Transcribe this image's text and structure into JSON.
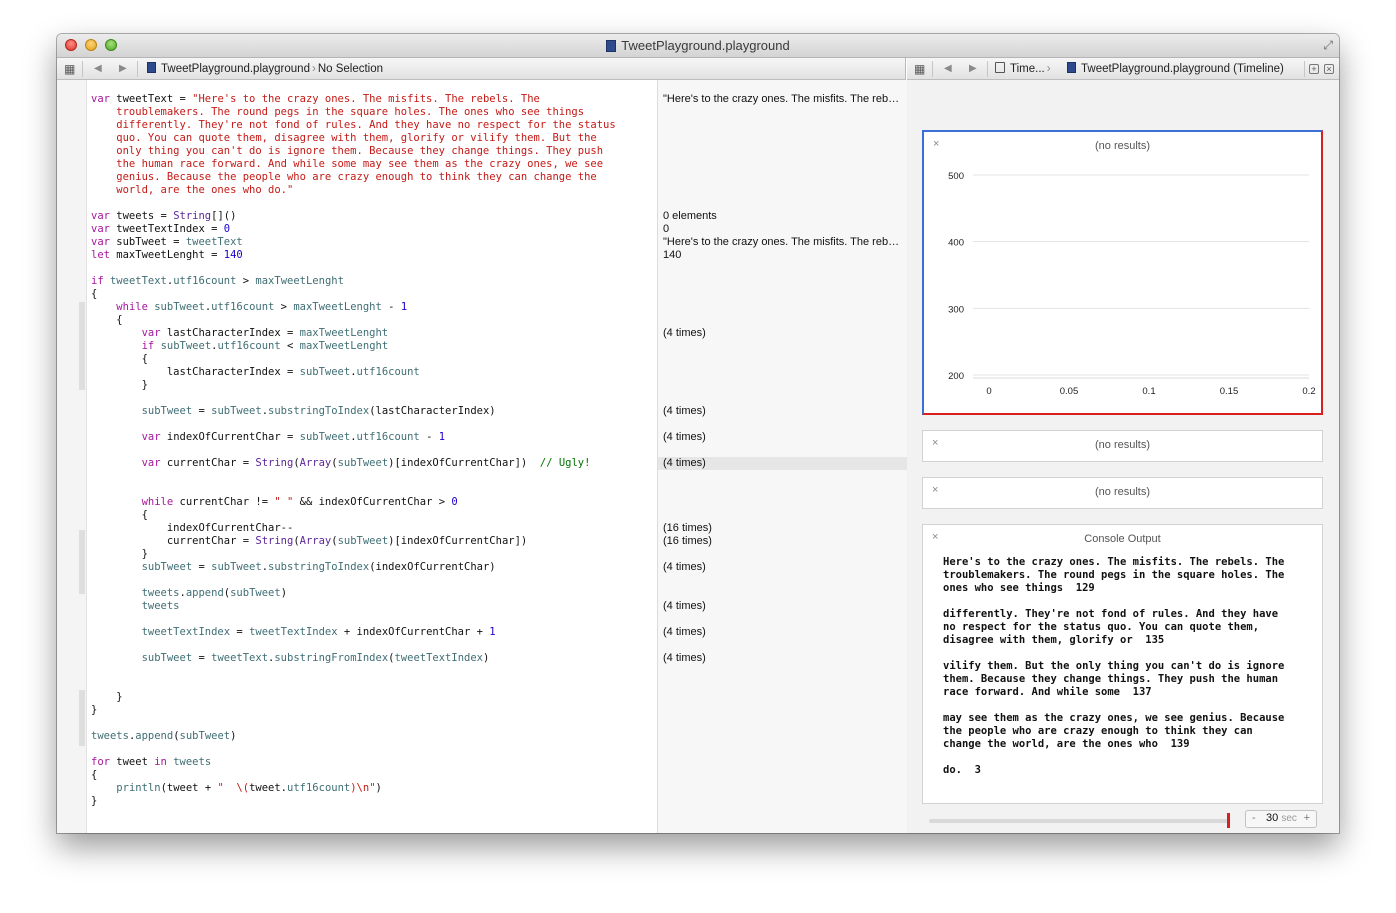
{
  "window": {
    "title": "TweetPlayground.playground"
  },
  "editor_jumpbar": {
    "file": "TweetPlayground.playground",
    "selection": "No Selection"
  },
  "assistant_jumpbar": {
    "mode": "Time...",
    "file": "TweetPlayground.playground (Timeline)"
  },
  "code_lines": [
    [
      [
        "kw",
        "var"
      ],
      [
        "t",
        " tweetText = "
      ],
      [
        "str",
        "\"Here's to the crazy ones. The misfits. The rebels. The"
      ]
    ],
    [
      [
        "str",
        "    troublemakers. The round pegs in the square holes. The ones who see things"
      ]
    ],
    [
      [
        "str",
        "    differently. They're not fond of rules. And they have no respect for the status"
      ]
    ],
    [
      [
        "str",
        "    quo. You can quote them, disagree with them, glorify or vilify them. But the"
      ]
    ],
    [
      [
        "str",
        "    only thing you can't do is ignore them. Because they change things. They push"
      ]
    ],
    [
      [
        "str",
        "    the human race forward. And while some may see them as the crazy ones, we see"
      ]
    ],
    [
      [
        "str",
        "    genius. Because the people who are crazy enough to think they can change the"
      ]
    ],
    [
      [
        "str",
        "    world, are the ones who do.\""
      ]
    ],
    [],
    [
      [
        "kw",
        "var"
      ],
      [
        "t",
        " tweets = "
      ],
      [
        "ty",
        "String"
      ],
      [
        "t",
        "[]()"
      ]
    ],
    [
      [
        "kw",
        "var"
      ],
      [
        "t",
        " tweetTextIndex = "
      ],
      [
        "num",
        "0"
      ]
    ],
    [
      [
        "kw",
        "var"
      ],
      [
        "t",
        " subTweet = "
      ],
      [
        "vr",
        "tweetText"
      ]
    ],
    [
      [
        "kw",
        "let"
      ],
      [
        "t",
        " maxTweetLenght = "
      ],
      [
        "num",
        "140"
      ]
    ],
    [],
    [
      [
        "kw",
        "if"
      ],
      [
        "t",
        " "
      ],
      [
        "vr",
        "tweetText"
      ],
      [
        "t",
        "."
      ],
      [
        "vr",
        "utf16count"
      ],
      [
        "t",
        " > "
      ],
      [
        "vr",
        "maxTweetLenght"
      ]
    ],
    [
      [
        "t",
        "{"
      ]
    ],
    [
      [
        "t",
        "    "
      ],
      [
        "kw",
        "while"
      ],
      [
        "t",
        " "
      ],
      [
        "vr",
        "subTweet"
      ],
      [
        "t",
        "."
      ],
      [
        "vr",
        "utf16count"
      ],
      [
        "t",
        " > "
      ],
      [
        "vr",
        "maxTweetLenght"
      ],
      [
        "t",
        " - "
      ],
      [
        "num",
        "1"
      ]
    ],
    [
      [
        "t",
        "    {"
      ]
    ],
    [
      [
        "t",
        "        "
      ],
      [
        "kw",
        "var"
      ],
      [
        "t",
        " lastCharacterIndex = "
      ],
      [
        "vr",
        "maxTweetLenght"
      ]
    ],
    [
      [
        "t",
        "        "
      ],
      [
        "kw",
        "if"
      ],
      [
        "t",
        " "
      ],
      [
        "vr",
        "subTweet"
      ],
      [
        "t",
        "."
      ],
      [
        "vr",
        "utf16count"
      ],
      [
        "t",
        " < "
      ],
      [
        "vr",
        "maxTweetLenght"
      ]
    ],
    [
      [
        "t",
        "        {"
      ]
    ],
    [
      [
        "t",
        "            lastCharacterIndex = "
      ],
      [
        "vr",
        "subTweet"
      ],
      [
        "t",
        "."
      ],
      [
        "vr",
        "utf16count"
      ]
    ],
    [
      [
        "t",
        "        }"
      ]
    ],
    [],
    [
      [
        "t",
        "        "
      ],
      [
        "vr",
        "subTweet"
      ],
      [
        "t",
        " = "
      ],
      [
        "vr",
        "subTweet"
      ],
      [
        "t",
        "."
      ],
      [
        "vr",
        "substringToIndex"
      ],
      [
        "t",
        "(lastCharacterIndex)"
      ]
    ],
    [],
    [
      [
        "t",
        "        "
      ],
      [
        "kw",
        "var"
      ],
      [
        "t",
        " indexOfCurrentChar = "
      ],
      [
        "vr",
        "subTweet"
      ],
      [
        "t",
        "."
      ],
      [
        "vr",
        "utf16count"
      ],
      [
        "t",
        " - "
      ],
      [
        "num",
        "1"
      ]
    ],
    [],
    [
      [
        "t",
        "        "
      ],
      [
        "kw",
        "var"
      ],
      [
        "t",
        " currentChar = "
      ],
      [
        "ty",
        "String"
      ],
      [
        "t",
        "("
      ],
      [
        "ty",
        "Array"
      ],
      [
        "t",
        "("
      ],
      [
        "vr",
        "subTweet"
      ],
      [
        "t",
        ")[indexOfCurrentChar])  "
      ],
      [
        "cm",
        "// Ugly!"
      ]
    ],
    [],
    [],
    [
      [
        "t",
        "        "
      ],
      [
        "kw",
        "while"
      ],
      [
        "t",
        " currentChar != "
      ],
      [
        "str",
        "\" \""
      ],
      [
        "t",
        " && indexOfCurrentChar > "
      ],
      [
        "num",
        "0"
      ]
    ],
    [
      [
        "t",
        "        {"
      ]
    ],
    [
      [
        "t",
        "            indexOfCurrentChar--"
      ]
    ],
    [
      [
        "t",
        "            currentChar = "
      ],
      [
        "ty",
        "String"
      ],
      [
        "t",
        "("
      ],
      [
        "ty",
        "Array"
      ],
      [
        "t",
        "("
      ],
      [
        "vr",
        "subTweet"
      ],
      [
        "t",
        ")[indexOfCurrentChar])"
      ]
    ],
    [
      [
        "t",
        "        }"
      ]
    ],
    [
      [
        "t",
        "        "
      ],
      [
        "vr",
        "subTweet"
      ],
      [
        "t",
        " = "
      ],
      [
        "vr",
        "subTweet"
      ],
      [
        "t",
        "."
      ],
      [
        "vr",
        "substringToIndex"
      ],
      [
        "t",
        "(indexOfCurrentChar)"
      ]
    ],
    [],
    [
      [
        "t",
        "        "
      ],
      [
        "vr",
        "tweets"
      ],
      [
        "t",
        "."
      ],
      [
        "vr",
        "append"
      ],
      [
        "t",
        "("
      ],
      [
        "vr",
        "subTweet"
      ],
      [
        "t",
        ")"
      ]
    ],
    [
      [
        "t",
        "        "
      ],
      [
        "vr",
        "tweets"
      ]
    ],
    [],
    [
      [
        "t",
        "        "
      ],
      [
        "vr",
        "tweetTextIndex"
      ],
      [
        "t",
        " = "
      ],
      [
        "vr",
        "tweetTextIndex"
      ],
      [
        "t",
        " + indexOfCurrentChar + "
      ],
      [
        "num",
        "1"
      ]
    ],
    [],
    [
      [
        "t",
        "        "
      ],
      [
        "vr",
        "subTweet"
      ],
      [
        "t",
        " = "
      ],
      [
        "vr",
        "tweetText"
      ],
      [
        "t",
        "."
      ],
      [
        "vr",
        "substringFromIndex"
      ],
      [
        "t",
        "("
      ],
      [
        "vr",
        "tweetTextIndex"
      ],
      [
        "t",
        ")"
      ]
    ],
    [],
    [],
    [
      [
        "t",
        "    }"
      ]
    ],
    [
      [
        "t",
        "}"
      ]
    ],
    [],
    [
      [
        "vr",
        "tweets"
      ],
      [
        "t",
        "."
      ],
      [
        "vr",
        "append"
      ],
      [
        "t",
        "("
      ],
      [
        "vr",
        "subTweet"
      ],
      [
        "t",
        ")"
      ]
    ],
    [],
    [
      [
        "kw",
        "for"
      ],
      [
        "t",
        " tweet "
      ],
      [
        "kw",
        "in"
      ],
      [
        "t",
        " "
      ],
      [
        "vr",
        "tweets"
      ]
    ],
    [
      [
        "t",
        "{"
      ]
    ],
    [
      [
        "t",
        "    "
      ],
      [
        "vr",
        "println"
      ],
      [
        "t",
        "(tweet + "
      ],
      [
        "str",
        "\"  \\("
      ],
      [
        "t",
        "tweet."
      ],
      [
        "vr",
        "utf16count"
      ],
      [
        "str",
        ")\\n\""
      ],
      [
        "t",
        ")"
      ]
    ],
    [
      [
        "t",
        "}"
      ]
    ]
  ],
  "results": [
    {
      "line": 0,
      "text": "\"Here's to the crazy ones. The misfits. The rebels. The troublemakers."
    },
    {
      "line": 9,
      "text": "0 elements"
    },
    {
      "line": 10,
      "text": "0"
    },
    {
      "line": 11,
      "text": "\"Here's to the crazy ones. The misfits. The rebels. The troublemakers."
    },
    {
      "line": 12,
      "text": "140"
    },
    {
      "line": 18,
      "text": "(4 times)"
    },
    {
      "line": 24,
      "text": "(4 times)"
    },
    {
      "line": 26,
      "text": "(4 times)"
    },
    {
      "line": 28,
      "text": "(4 times)",
      "highlight": true
    },
    {
      "line": 33,
      "text": "(16 times)"
    },
    {
      "line": 34,
      "text": "(16 times)"
    },
    {
      "line": 36,
      "text": "(4 times)"
    },
    {
      "line": 39,
      "text": "(4 times)"
    },
    {
      "line": 41,
      "text": "(4 times)"
    },
    {
      "line": 43,
      "text": "(4 times)"
    }
  ],
  "timeline": {
    "chart_panel": {
      "title": "(no results)",
      "close": "×"
    },
    "panel2": {
      "title": "(no results)",
      "close": "×"
    },
    "panel3": {
      "title": "(no results)",
      "close": "×"
    },
    "console": {
      "title": "Console Output",
      "close": "×",
      "text": "Here's to the crazy ones. The misfits. The rebels. The\ntroublemakers. The round pegs in the square holes. The\nones who see things  129\n\ndifferently. They're not fond of rules. And they have\nno respect for the status quo. You can quote them,\ndisagree with them, glorify or  135\n\nvilify them. But the only thing you can't do is ignore\nthem. Because they change things. They push the human\nrace forward. And while some  137\n\nmay see them as the crazy ones, we see genius. Because\nthe people who are crazy enough to think they can\nchange the world, are the ones who  139\n\ndo.  3"
    },
    "duration": {
      "minus": "-",
      "value": "30",
      "unit": "sec",
      "plus": "+"
    }
  },
  "chart_data": {
    "type": "line",
    "title": "(no results)",
    "series": [],
    "x_ticks": [
      "0",
      "0.05",
      "0.1",
      "0.15",
      "0.2"
    ],
    "y_ticks": [
      "200",
      "300",
      "400",
      "500"
    ],
    "xlim": [
      0,
      0.2
    ],
    "ylim": [
      200,
      500
    ],
    "grid": true
  }
}
